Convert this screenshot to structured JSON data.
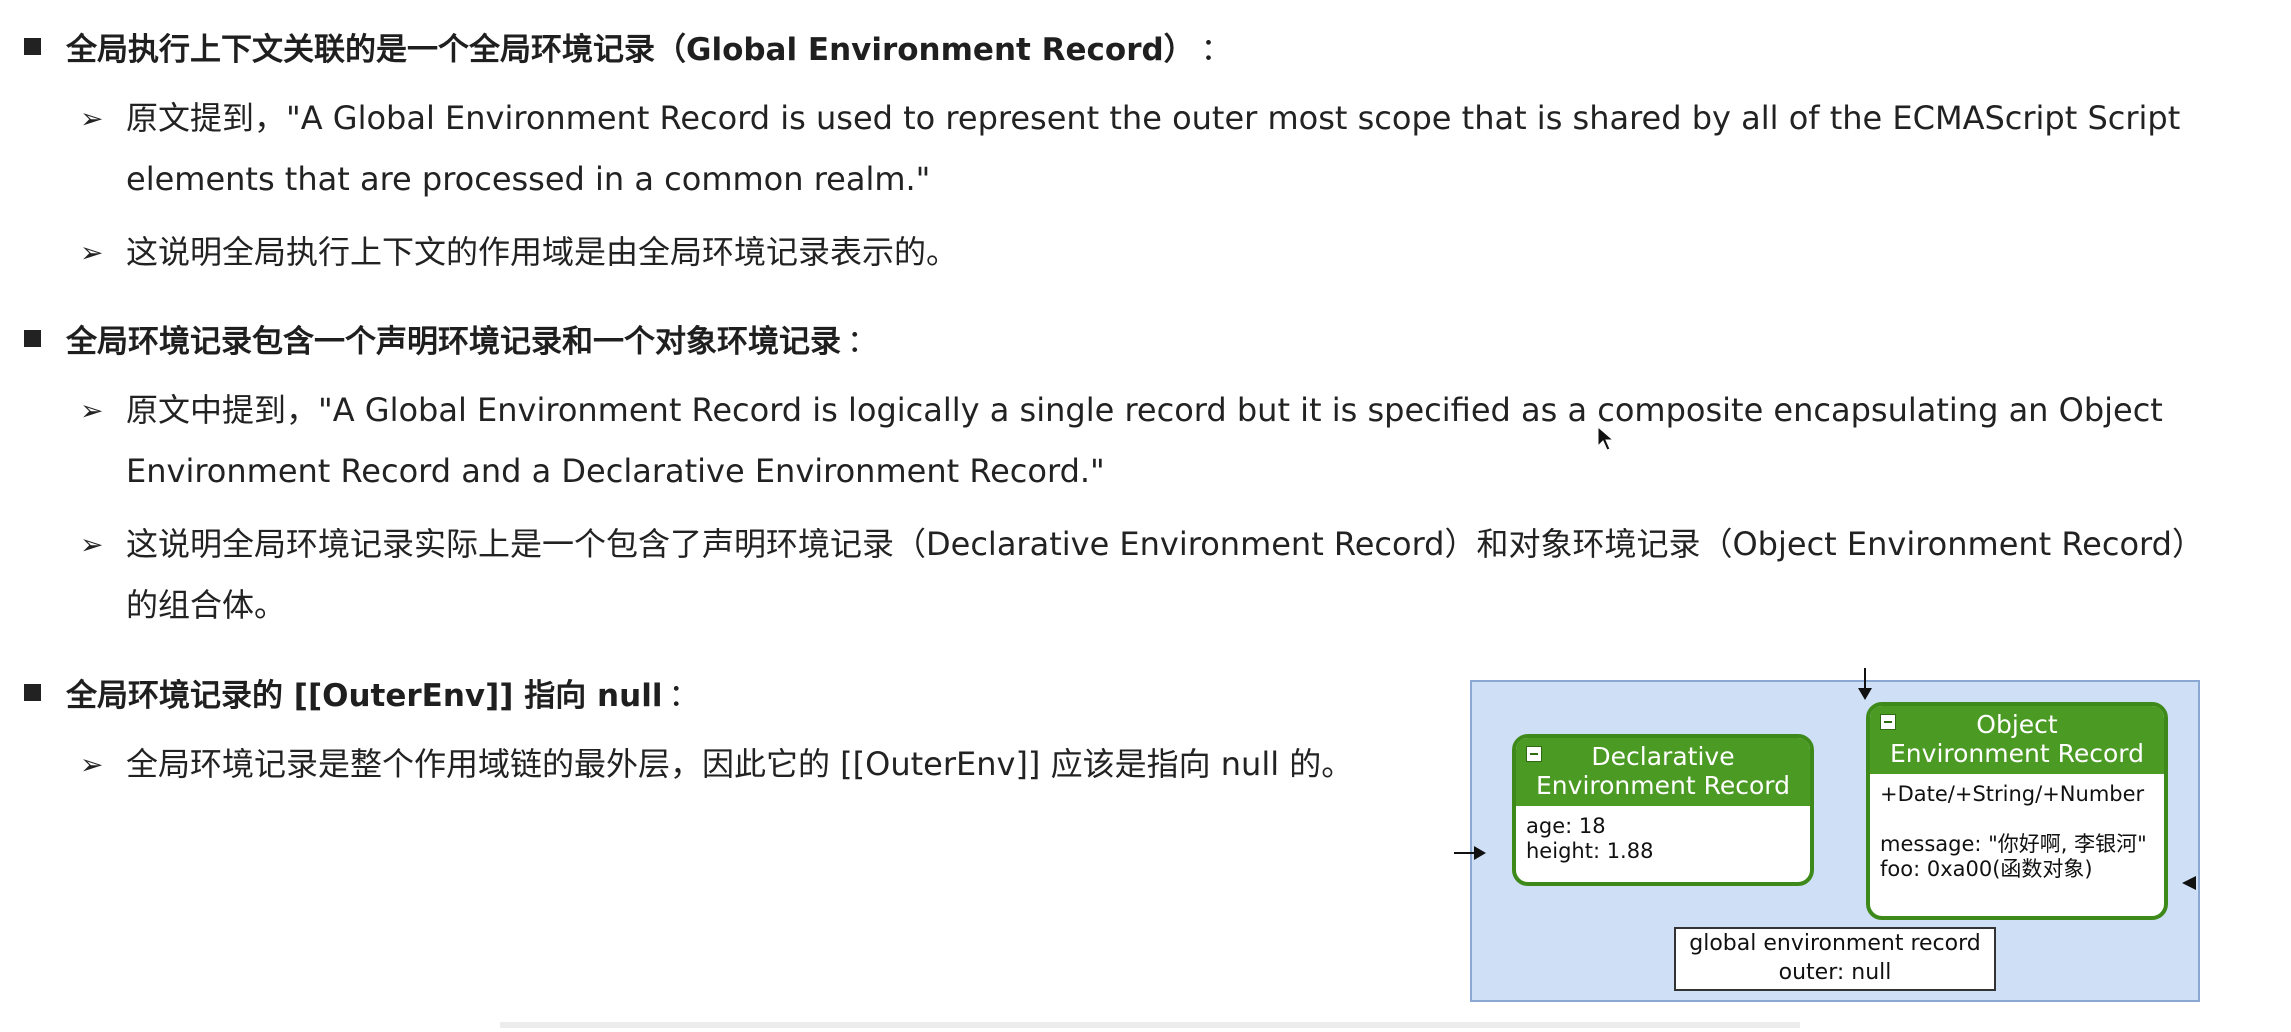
{
  "section1": {
    "heading": "全局执行上下文关联的是一个全局环境记录（Global Environment Record）",
    "colon": "：",
    "items": [
      {
        "line1": "原文提到，\"A Global Environment Record is used to represent the outer most scope that is shared by all of the ECMAScript Script",
        "line2": "elements that are processed in a common realm.\""
      },
      {
        "line1": "这说明全局执行上下文的作用域是由全局环境记录表示的。"
      }
    ]
  },
  "section2": {
    "heading": "全局环境记录包含一个声明环境记录和一个对象环境记录",
    "colon": "：",
    "items": [
      {
        "line1": "原文中提到，\"A Global Environment Record is logically a single record but it is specified as a composite encapsulating an Object",
        "line2": "Environment Record and a Declarative Environment Record.\""
      },
      {
        "line1": "这说明全局环境记录实际上是一个包含了声明环境记录（Declarative Environment Record）和对象环境记录（Object Environment Record）",
        "line2": "的组合体。"
      }
    ]
  },
  "section3": {
    "heading": "全局环境记录的 [[OuterEnv]] 指向 null",
    "colon": "：",
    "items": [
      {
        "line1": "全局环境记录是整个作用域链的最外层，因此它的 [[OuterEnv]] 应该是指向 null 的。"
      }
    ]
  },
  "diagram": {
    "declarative": {
      "title_line1": "Declarative",
      "title_line2": "Environment Record",
      "body_line1": "age: 18",
      "body_line2": "height: 1.88"
    },
    "object": {
      "title_line1": "Object",
      "title_line2": "Environment Record",
      "body_line1": "+Date/+String/+Number",
      "body_line2": "message: \"你好啊, 李银河\"",
      "body_line3": "foo: 0xa00(函数对象)"
    },
    "global": {
      "line1": "global environment record",
      "line2": "outer: null"
    },
    "colors": {
      "background": "#cfe0f6",
      "record_header": "#4b9a24",
      "record_border": "#3d8a1a"
    }
  }
}
